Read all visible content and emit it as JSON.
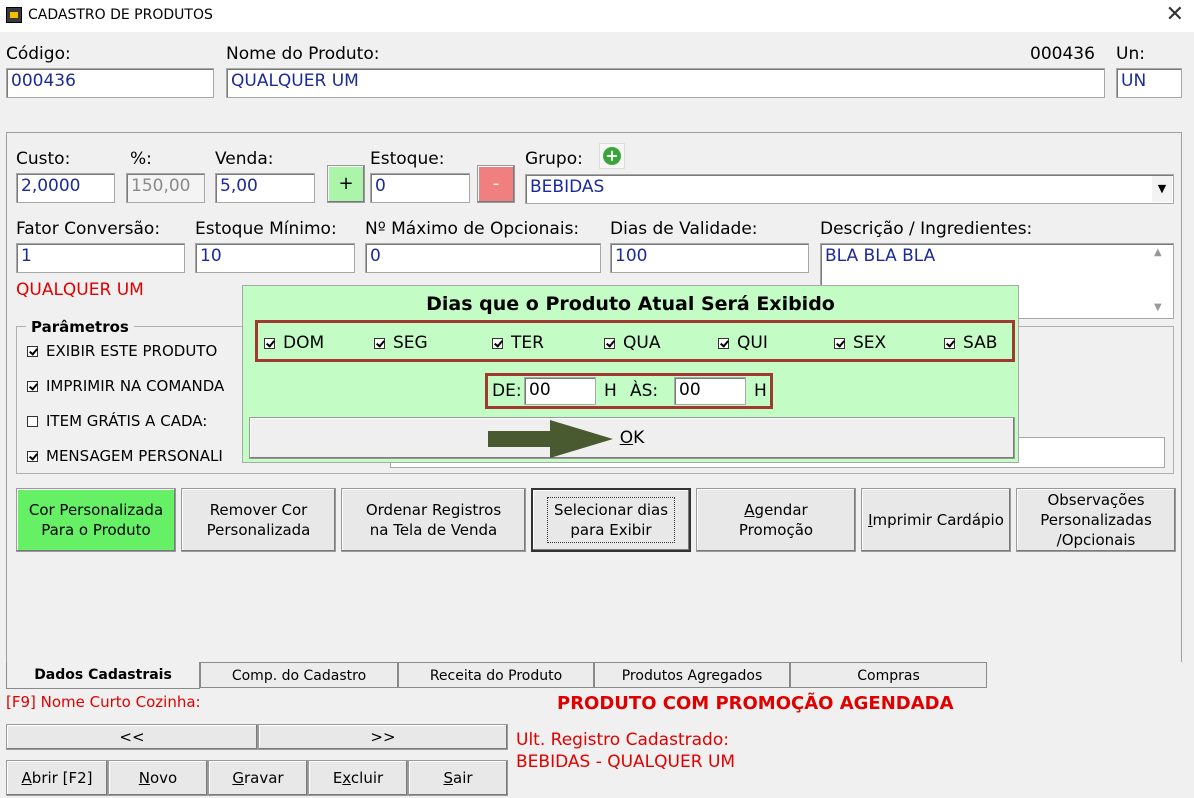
{
  "window": {
    "title": "CADASTRO DE PRODUTOS",
    "close": "✕"
  },
  "header": {
    "codigo_label": "Código:",
    "codigo_value": "000436",
    "nome_label": "Nome do Produto:",
    "nome_value": "QUALQUER UM",
    "code_readout": "000436",
    "un_label": "Un:",
    "un_value": "UN"
  },
  "form": {
    "custo_label": "Custo:",
    "custo_value": "2,0000",
    "pct_label": "%:",
    "pct_value": "150,00",
    "venda_label": "Venda:",
    "venda_value": "5,00",
    "plus_label": "+",
    "estoque_label": "Estoque:",
    "estoque_value": "0",
    "minus_label": "-",
    "grupo_label": "Grupo:",
    "grupo_value": "BEBIDAS",
    "fator_label": "Fator Conversão:",
    "fator_value": "1",
    "estmin_label": "Estoque Mínimo:",
    "estmin_value": "10",
    "maxop_label": "Nº Máximo de Opcionais:",
    "maxop_value": "0",
    "validade_label": "Dias de Validade:",
    "validade_value": "100",
    "descricao_label": "Descrição / Ingredientes:",
    "descricao_value": "BLA BLA BLA",
    "nome_curto_red": "QUALQUER UM"
  },
  "parametros": {
    "title": "Parâmetros",
    "items": [
      {
        "label": "EXIBIR ESTE PRODUTO",
        "checked": true
      },
      {
        "label": "IMPRIMIR NA COMANDA",
        "checked": true
      },
      {
        "label": "ITEM GRÁTIS A CADA:",
        "checked": false
      },
      {
        "label": "MENSAGEM PERSONALI",
        "checked": true
      }
    ]
  },
  "popup": {
    "title": "Dias que o Produto Atual Será Exibido",
    "days": [
      {
        "label": "DOM",
        "checked": true
      },
      {
        "label": "SEG",
        "checked": true
      },
      {
        "label": "TER",
        "checked": true
      },
      {
        "label": "QUA",
        "checked": true
      },
      {
        "label": "QUI",
        "checked": true
      },
      {
        "label": "SEX",
        "checked": true
      },
      {
        "label": "SAB",
        "checked": true
      }
    ],
    "de_label": "DE:",
    "de_value": "00",
    "h1": "H",
    "as_label": "ÀS:",
    "as_value": "00",
    "h2": "H",
    "ok_label": "OK"
  },
  "actions": {
    "cor": "Cor Personalizada\nPara o Produto",
    "remover": "Remover Cor\nPersonalizada",
    "ordenar": "Ordenar Registros\nna Tela de Venda",
    "selecionar": "Selecionar dias\npara  Exibir",
    "agendar": "Agendar\nPromoção",
    "imprimir": "Imprimir Cardápio",
    "observacoes": "Observações\nPersonalizadas\n/Opcionais"
  },
  "tabs": [
    "Dados Cadastrais",
    "Comp. do Cadastro",
    "Receita do Produto",
    "Produtos Agregados",
    "Compras"
  ],
  "footer": {
    "f9": "[F9] Nome Curto Cozinha:",
    "promo": "PRODUTO COM PROMOÇÃO AGENDADA",
    "prev": "<<",
    "next": ">>",
    "ult_label": "Ult. Registro Cadastrado:",
    "ult_value": "BEBIDAS - QUALQUER UM",
    "abrir": "Abrir [F2]",
    "novo": "Novo",
    "gravar": "Gravar",
    "excluir": "Excluir",
    "sair": "Sair"
  },
  "colors": {
    "accent_green": "#66f066",
    "minus_red": "#f08080",
    "popup_bg": "#c3fcc4",
    "highlight_border": "#a03a30",
    "alert_red": "#e00000"
  }
}
